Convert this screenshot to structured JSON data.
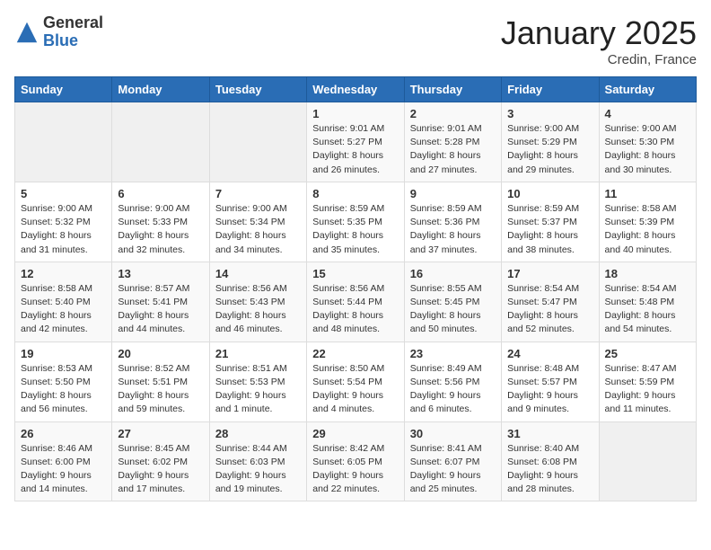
{
  "logo": {
    "general": "General",
    "blue": "Blue"
  },
  "header": {
    "month": "January 2025",
    "location": "Credin, France"
  },
  "weekdays": [
    "Sunday",
    "Monday",
    "Tuesday",
    "Wednesday",
    "Thursday",
    "Friday",
    "Saturday"
  ],
  "weeks": [
    [
      {
        "day": "",
        "info": ""
      },
      {
        "day": "",
        "info": ""
      },
      {
        "day": "",
        "info": ""
      },
      {
        "day": "1",
        "info": "Sunrise: 9:01 AM\nSunset: 5:27 PM\nDaylight: 8 hours and 26 minutes."
      },
      {
        "day": "2",
        "info": "Sunrise: 9:01 AM\nSunset: 5:28 PM\nDaylight: 8 hours and 27 minutes."
      },
      {
        "day": "3",
        "info": "Sunrise: 9:00 AM\nSunset: 5:29 PM\nDaylight: 8 hours and 29 minutes."
      },
      {
        "day": "4",
        "info": "Sunrise: 9:00 AM\nSunset: 5:30 PM\nDaylight: 8 hours and 30 minutes."
      }
    ],
    [
      {
        "day": "5",
        "info": "Sunrise: 9:00 AM\nSunset: 5:32 PM\nDaylight: 8 hours and 31 minutes."
      },
      {
        "day": "6",
        "info": "Sunrise: 9:00 AM\nSunset: 5:33 PM\nDaylight: 8 hours and 32 minutes."
      },
      {
        "day": "7",
        "info": "Sunrise: 9:00 AM\nSunset: 5:34 PM\nDaylight: 8 hours and 34 minutes."
      },
      {
        "day": "8",
        "info": "Sunrise: 8:59 AM\nSunset: 5:35 PM\nDaylight: 8 hours and 35 minutes."
      },
      {
        "day": "9",
        "info": "Sunrise: 8:59 AM\nSunset: 5:36 PM\nDaylight: 8 hours and 37 minutes."
      },
      {
        "day": "10",
        "info": "Sunrise: 8:59 AM\nSunset: 5:37 PM\nDaylight: 8 hours and 38 minutes."
      },
      {
        "day": "11",
        "info": "Sunrise: 8:58 AM\nSunset: 5:39 PM\nDaylight: 8 hours and 40 minutes."
      }
    ],
    [
      {
        "day": "12",
        "info": "Sunrise: 8:58 AM\nSunset: 5:40 PM\nDaylight: 8 hours and 42 minutes."
      },
      {
        "day": "13",
        "info": "Sunrise: 8:57 AM\nSunset: 5:41 PM\nDaylight: 8 hours and 44 minutes."
      },
      {
        "day": "14",
        "info": "Sunrise: 8:56 AM\nSunset: 5:43 PM\nDaylight: 8 hours and 46 minutes."
      },
      {
        "day": "15",
        "info": "Sunrise: 8:56 AM\nSunset: 5:44 PM\nDaylight: 8 hours and 48 minutes."
      },
      {
        "day": "16",
        "info": "Sunrise: 8:55 AM\nSunset: 5:45 PM\nDaylight: 8 hours and 50 minutes."
      },
      {
        "day": "17",
        "info": "Sunrise: 8:54 AM\nSunset: 5:47 PM\nDaylight: 8 hours and 52 minutes."
      },
      {
        "day": "18",
        "info": "Sunrise: 8:54 AM\nSunset: 5:48 PM\nDaylight: 8 hours and 54 minutes."
      }
    ],
    [
      {
        "day": "19",
        "info": "Sunrise: 8:53 AM\nSunset: 5:50 PM\nDaylight: 8 hours and 56 minutes."
      },
      {
        "day": "20",
        "info": "Sunrise: 8:52 AM\nSunset: 5:51 PM\nDaylight: 8 hours and 59 minutes."
      },
      {
        "day": "21",
        "info": "Sunrise: 8:51 AM\nSunset: 5:53 PM\nDaylight: 9 hours and 1 minute."
      },
      {
        "day": "22",
        "info": "Sunrise: 8:50 AM\nSunset: 5:54 PM\nDaylight: 9 hours and 4 minutes."
      },
      {
        "day": "23",
        "info": "Sunrise: 8:49 AM\nSunset: 5:56 PM\nDaylight: 9 hours and 6 minutes."
      },
      {
        "day": "24",
        "info": "Sunrise: 8:48 AM\nSunset: 5:57 PM\nDaylight: 9 hours and 9 minutes."
      },
      {
        "day": "25",
        "info": "Sunrise: 8:47 AM\nSunset: 5:59 PM\nDaylight: 9 hours and 11 minutes."
      }
    ],
    [
      {
        "day": "26",
        "info": "Sunrise: 8:46 AM\nSunset: 6:00 PM\nDaylight: 9 hours and 14 minutes."
      },
      {
        "day": "27",
        "info": "Sunrise: 8:45 AM\nSunset: 6:02 PM\nDaylight: 9 hours and 17 minutes."
      },
      {
        "day": "28",
        "info": "Sunrise: 8:44 AM\nSunset: 6:03 PM\nDaylight: 9 hours and 19 minutes."
      },
      {
        "day": "29",
        "info": "Sunrise: 8:42 AM\nSunset: 6:05 PM\nDaylight: 9 hours and 22 minutes."
      },
      {
        "day": "30",
        "info": "Sunrise: 8:41 AM\nSunset: 6:07 PM\nDaylight: 9 hours and 25 minutes."
      },
      {
        "day": "31",
        "info": "Sunrise: 8:40 AM\nSunset: 6:08 PM\nDaylight: 9 hours and 28 minutes."
      },
      {
        "day": "",
        "info": ""
      }
    ]
  ]
}
